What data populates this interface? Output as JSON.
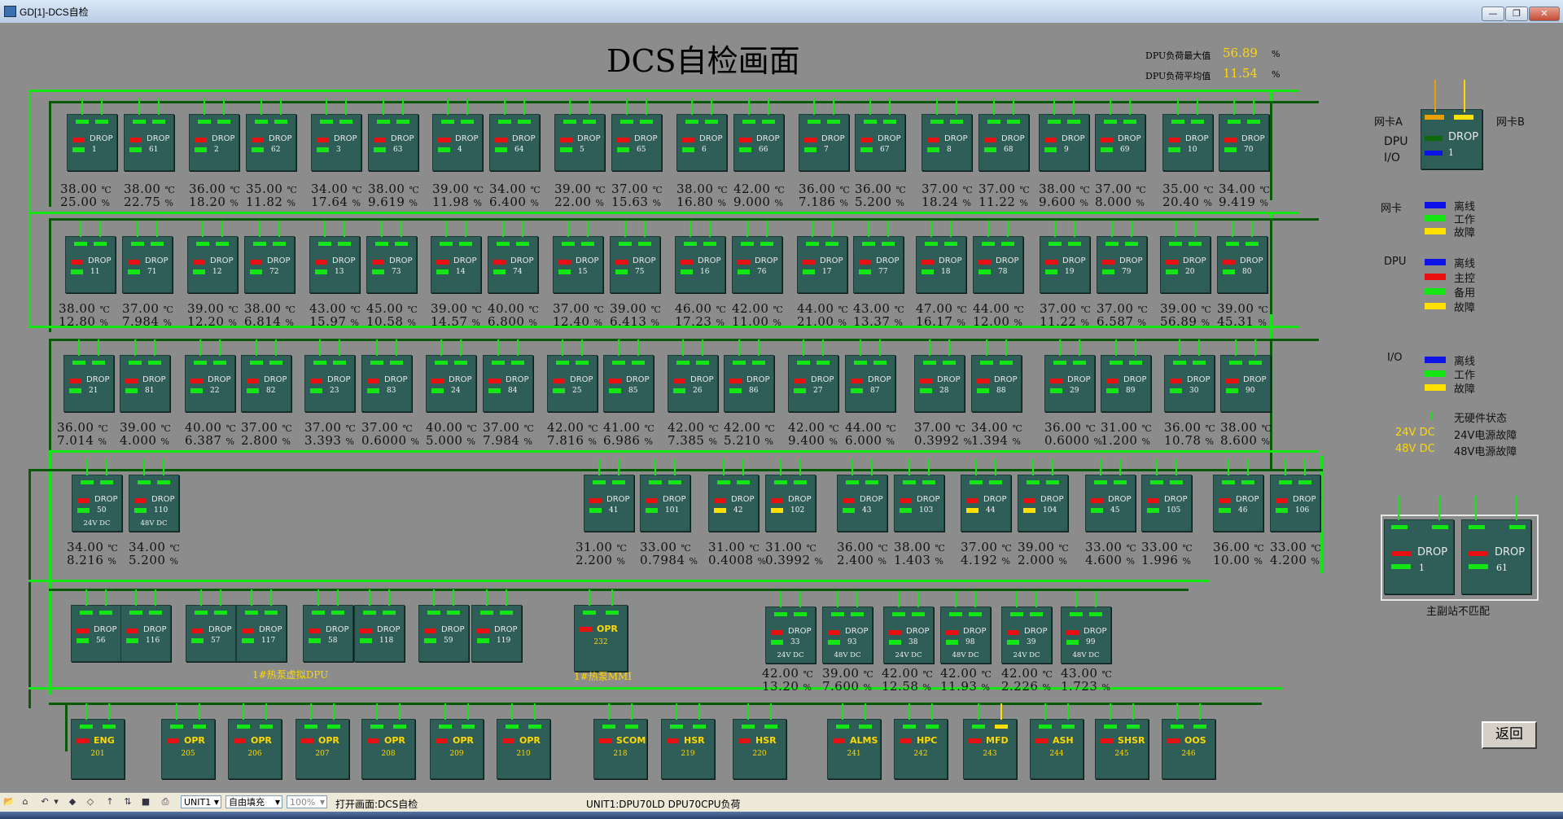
{
  "window": {
    "title": "GD[1]-DCS自检",
    "min_label": "—",
    "restore_label": "❐",
    "close_label": "✕"
  },
  "screen": {
    "title": "DCS自检画面",
    "dpu_max_label": "DPU负荷最大值",
    "dpu_max_value": "56.89",
    "dpu_avg_label": "DPU负荷平均值",
    "dpu_avg_value": "11.54",
    "percent": "%"
  },
  "units": {
    "celsius": "℃",
    "percent": "%"
  },
  "colors": {
    "green": "#13e613",
    "red": "#e81010",
    "yellow": "#ffe000",
    "blue": "#0d12e8",
    "darkgreen": "#0c6a0c",
    "orange": "#e8a000",
    "device_body": "#2f5e58"
  },
  "devices": [
    {
      "kind": "DROP",
      "id": "1",
      "temp": "38.00",
      "load": "25.00"
    },
    {
      "kind": "DROP",
      "id": "61",
      "temp": "38.00",
      "load": "22.75"
    },
    {
      "kind": "DROP",
      "id": "2",
      "temp": "36.00",
      "load": "18.20"
    },
    {
      "kind": "DROP",
      "id": "62",
      "temp": "35.00",
      "load": "11.82"
    },
    {
      "kind": "DROP",
      "id": "3",
      "temp": "34.00",
      "load": "17.64"
    },
    {
      "kind": "DROP",
      "id": "63",
      "temp": "38.00",
      "load": "9.619"
    },
    {
      "kind": "DROP",
      "id": "4",
      "temp": "39.00",
      "load": "11.98"
    },
    {
      "kind": "DROP",
      "id": "64",
      "temp": "34.00",
      "load": "6.400"
    },
    {
      "kind": "DROP",
      "id": "5",
      "temp": "39.00",
      "load": "22.00"
    },
    {
      "kind": "DROP",
      "id": "65",
      "temp": "37.00",
      "load": "15.63"
    },
    {
      "kind": "DROP",
      "id": "6",
      "temp": "38.00",
      "load": "16.80"
    },
    {
      "kind": "DROP",
      "id": "66",
      "temp": "42.00",
      "load": "9.000"
    },
    {
      "kind": "DROP",
      "id": "7",
      "temp": "36.00",
      "load": "7.186"
    },
    {
      "kind": "DROP",
      "id": "67",
      "temp": "36.00",
      "load": "5.200"
    },
    {
      "kind": "DROP",
      "id": "8",
      "temp": "37.00",
      "load": "18.24"
    },
    {
      "kind": "DROP",
      "id": "68",
      "temp": "37.00",
      "load": "11.22"
    },
    {
      "kind": "DROP",
      "id": "9",
      "temp": "38.00",
      "load": "9.600"
    },
    {
      "kind": "DROP",
      "id": "69",
      "temp": "37.00",
      "load": "8.000"
    },
    {
      "kind": "DROP",
      "id": "10",
      "temp": "35.00",
      "load": "20.40"
    },
    {
      "kind": "DROP",
      "id": "70",
      "temp": "34.00",
      "load": "9.419"
    },
    {
      "kind": "DROP",
      "id": "11",
      "temp": "38.00",
      "load": "12.80"
    },
    {
      "kind": "DROP",
      "id": "71",
      "temp": "37.00",
      "load": "7.984"
    },
    {
      "kind": "DROP",
      "id": "12",
      "temp": "39.00",
      "load": "12.20"
    },
    {
      "kind": "DROP",
      "id": "72",
      "temp": "38.00",
      "load": "6.814"
    },
    {
      "kind": "DROP",
      "id": "13",
      "temp": "43.00",
      "load": "15.97"
    },
    {
      "kind": "DROP",
      "id": "73",
      "temp": "45.00",
      "load": "10.58"
    },
    {
      "kind": "DROP",
      "id": "14",
      "temp": "39.00",
      "load": "14.57"
    },
    {
      "kind": "DROP",
      "id": "74",
      "temp": "40.00",
      "load": "6.800"
    },
    {
      "kind": "DROP",
      "id": "15",
      "temp": "37.00",
      "load": "12.40"
    },
    {
      "kind": "DROP",
      "id": "75",
      "temp": "39.00",
      "load": "6.413"
    },
    {
      "kind": "DROP",
      "id": "16",
      "temp": "46.00",
      "load": "17.23"
    },
    {
      "kind": "DROP",
      "id": "76",
      "temp": "42.00",
      "load": "11.00"
    },
    {
      "kind": "DROP",
      "id": "17",
      "temp": "44.00",
      "load": "21.00"
    },
    {
      "kind": "DROP",
      "id": "77",
      "temp": "43.00",
      "load": "13.37"
    },
    {
      "kind": "DROP",
      "id": "18",
      "temp": "47.00",
      "load": "16.17"
    },
    {
      "kind": "DROP",
      "id": "78",
      "temp": "44.00",
      "load": "12.00"
    },
    {
      "kind": "DROP",
      "id": "19",
      "temp": "37.00",
      "load": "11.22"
    },
    {
      "kind": "DROP",
      "id": "79",
      "temp": "37.00",
      "load": "6.587"
    },
    {
      "kind": "DROP",
      "id": "20",
      "temp": "39.00",
      "load": "56.89"
    },
    {
      "kind": "DROP",
      "id": "80",
      "temp": "39.00",
      "load": "45.31"
    },
    {
      "kind": "DROP",
      "id": "21",
      "temp": "36.00",
      "load": "7.014"
    },
    {
      "kind": "DROP",
      "id": "81",
      "temp": "39.00",
      "load": "4.000"
    },
    {
      "kind": "DROP",
      "id": "22",
      "temp": "40.00",
      "load": "6.387"
    },
    {
      "kind": "DROP",
      "id": "82",
      "temp": "37.00",
      "load": "2.800"
    },
    {
      "kind": "DROP",
      "id": "23",
      "temp": "37.00",
      "load": "3.393"
    },
    {
      "kind": "DROP",
      "id": "83",
      "temp": "37.00",
      "load": "0.6000"
    },
    {
      "kind": "DROP",
      "id": "24",
      "temp": "40.00",
      "load": "5.000"
    },
    {
      "kind": "DROP",
      "id": "84",
      "temp": "37.00",
      "load": "7.984"
    },
    {
      "kind": "DROP",
      "id": "25",
      "temp": "42.00",
      "load": "7.816"
    },
    {
      "kind": "DROP",
      "id": "85",
      "temp": "41.00",
      "load": "6.986"
    },
    {
      "kind": "DROP",
      "id": "26",
      "temp": "42.00",
      "load": "7.385"
    },
    {
      "kind": "DROP",
      "id": "86",
      "temp": "42.00",
      "load": "5.210"
    },
    {
      "kind": "DROP",
      "id": "27",
      "temp": "42.00",
      "load": "9.400"
    },
    {
      "kind": "DROP",
      "id": "87",
      "temp": "44.00",
      "load": "6.000"
    },
    {
      "kind": "DROP",
      "id": "28",
      "temp": "37.00",
      "load": "0.3992"
    },
    {
      "kind": "DROP",
      "id": "88",
      "temp": "34.00",
      "load": "1.394"
    },
    {
      "kind": "DROP",
      "id": "29",
      "temp": "36.00",
      "load": "0.6000"
    },
    {
      "kind": "DROP",
      "id": "89",
      "temp": "31.00",
      "load": "1.200"
    },
    {
      "kind": "DROP",
      "id": "30",
      "temp": "36.00",
      "load": "10.78"
    },
    {
      "kind": "DROP",
      "id": "90",
      "temp": "38.00",
      "load": "8.600"
    },
    {
      "kind": "DROP",
      "id": "50",
      "sub": "24V DC",
      "temp": "34.00",
      "load": "8.216"
    },
    {
      "kind": "DROP",
      "id": "110",
      "sub": "48V DC",
      "temp": "34.00",
      "load": "5.200"
    },
    {
      "kind": "DROP",
      "id": "41",
      "temp": "31.00",
      "load": "2.200"
    },
    {
      "kind": "DROP",
      "id": "101",
      "temp": "33.00",
      "load": "0.7984"
    },
    {
      "kind": "DROP",
      "id": "42",
      "temp": "31.00",
      "load": "0.4008",
      "bar": "yellow"
    },
    {
      "kind": "DROP",
      "id": "102",
      "temp": "31.00",
      "load": "0.3992",
      "bar": "yellow"
    },
    {
      "kind": "DROP",
      "id": "43",
      "temp": "36.00",
      "load": "2.400"
    },
    {
      "kind": "DROP",
      "id": "103",
      "temp": "38.00",
      "load": "1.403"
    },
    {
      "kind": "DROP",
      "id": "44",
      "temp": "37.00",
      "load": "4.192",
      "bar": "yellow"
    },
    {
      "kind": "DROP",
      "id": "104",
      "temp": "39.00",
      "load": "2.000",
      "bar": "yellow"
    },
    {
      "kind": "DROP",
      "id": "45",
      "temp": "33.00",
      "load": "4.600"
    },
    {
      "kind": "DROP",
      "id": "105",
      "temp": "33.00",
      "load": "1.996"
    },
    {
      "kind": "DROP",
      "id": "46",
      "temp": "36.00",
      "load": "10.00"
    },
    {
      "kind": "DROP",
      "id": "106",
      "temp": "33.00",
      "load": "4.200"
    },
    {
      "kind": "DROP",
      "id": "56"
    },
    {
      "kind": "DROP",
      "id": "116"
    },
    {
      "kind": "DROP",
      "id": "57"
    },
    {
      "kind": "DROP",
      "id": "117"
    },
    {
      "kind": "DROP",
      "id": "58"
    },
    {
      "kind": "DROP",
      "id": "118"
    },
    {
      "kind": "DROP",
      "id": "59"
    },
    {
      "kind": "DROP",
      "id": "119"
    },
    {
      "kind": "OPR",
      "id": "232"
    },
    {
      "kind": "DROP",
      "id": "33",
      "sub": "24V DC",
      "temp": "42.00",
      "load": "13.20"
    },
    {
      "kind": "DROP",
      "id": "93",
      "sub": "48V DC",
      "temp": "39.00",
      "load": "7.600"
    },
    {
      "kind": "DROP",
      "id": "38",
      "sub": "24V DC",
      "temp": "42.00",
      "load": "12.58"
    },
    {
      "kind": "DROP",
      "id": "98",
      "sub": "48V DC",
      "temp": "42.00",
      "load": "11.93"
    },
    {
      "kind": "DROP",
      "id": "39",
      "sub": "24V DC",
      "temp": "42.00",
      "load": "2.226"
    },
    {
      "kind": "DROP",
      "id": "99",
      "sub": "48V DC",
      "temp": "43.00",
      "load": "1.723"
    },
    {
      "kind": "ENG",
      "id": "201"
    },
    {
      "kind": "OPR",
      "id": "205"
    },
    {
      "kind": "OPR",
      "id": "206"
    },
    {
      "kind": "OPR",
      "id": "207"
    },
    {
      "kind": "OPR",
      "id": "208"
    },
    {
      "kind": "OPR",
      "id": "209"
    },
    {
      "kind": "OPR",
      "id": "210"
    },
    {
      "kind": "SCOM",
      "id": "218"
    },
    {
      "kind": "HSR",
      "id": "219"
    },
    {
      "kind": "HSR",
      "id": "220"
    },
    {
      "kind": "ALMS",
      "id": "241"
    },
    {
      "kind": "HPC",
      "id": "242"
    },
    {
      "kind": "MFD",
      "id": "243",
      "nic": "yellow"
    },
    {
      "kind": "ASH",
      "id": "244"
    },
    {
      "kind": "SHSR",
      "id": "245"
    },
    {
      "kind": "OOS",
      "id": "246"
    }
  ],
  "group_labels": {
    "virtual_dpu": "1#热泵虚拟DPU",
    "mmi": "1#热泵MMI"
  },
  "legend": {
    "nic_a": "网卡A",
    "nic_b": "网卡B",
    "sample": {
      "kind": "DROP",
      "id": "1"
    },
    "dpu_io": "DPU\nI/O",
    "nic_title": "网卡",
    "nic_items": [
      "离线",
      "工作",
      "故障"
    ],
    "dpu_title": "DPU",
    "dpu_items": [
      "离线",
      "主控",
      "备用",
      "故障"
    ],
    "io_title": "I/O",
    "io_items": [
      "离线",
      "工作",
      "故障"
    ],
    "hw_none": "无硬件状态",
    "v24": "24V DC",
    "v24_desc": "24V电源故障",
    "v48": "48V DC",
    "v48_desc": "48V电源故障",
    "mismatch_devices": [
      {
        "kind": "DROP",
        "id": "1"
      },
      {
        "kind": "DROP",
        "id": "61"
      }
    ],
    "mismatch_label": "主副站不匹配"
  },
  "buttons": {
    "back": "返回"
  },
  "statusbar": {
    "unit_select": "UNIT1",
    "fill_select": "自由填充",
    "zoom_select": "100%",
    "open_text": "打开画面:DCS自检",
    "info_text": "UNIT1:DPU70LD DPU70CPU负荷"
  }
}
